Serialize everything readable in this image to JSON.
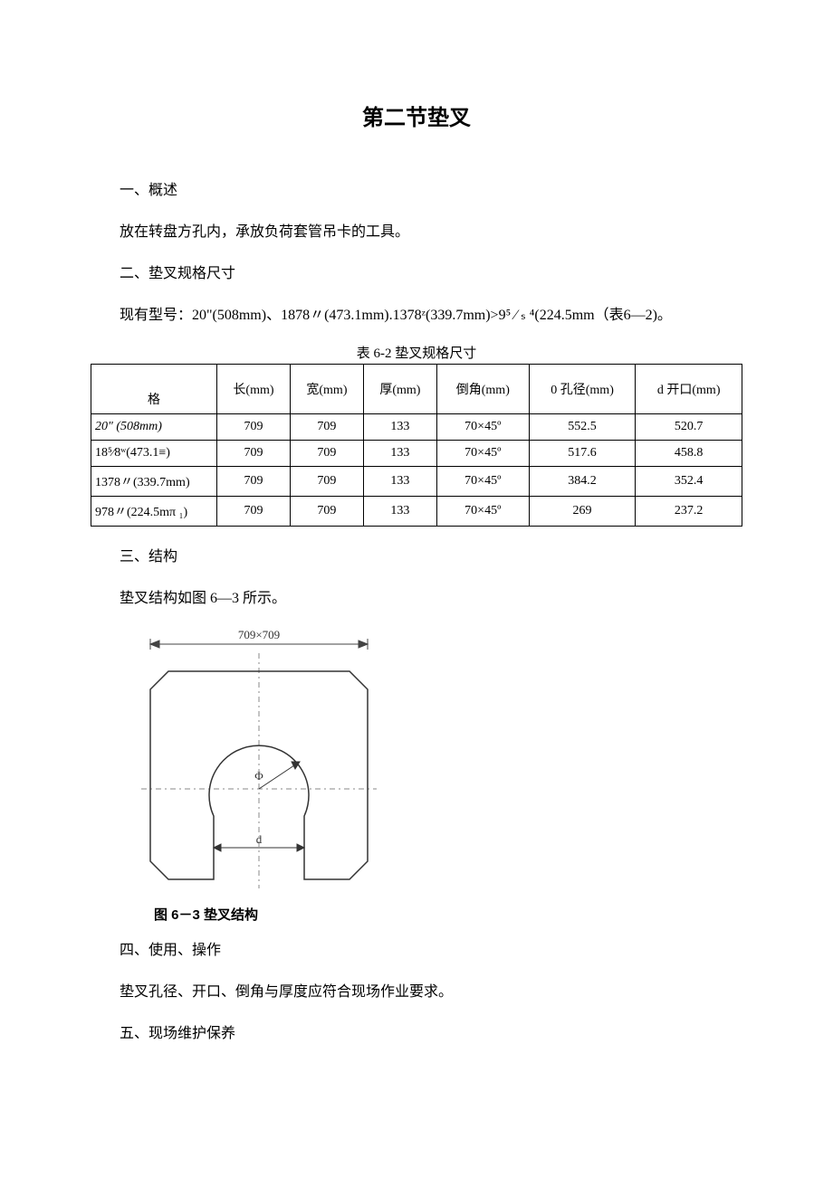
{
  "title": "第二节垫叉",
  "sec1_heading": "一、概述",
  "sec1_text": "放在转盘方孔内，承放负荷套管吊卡的工具。",
  "sec2_heading": "二、垫叉规格尺寸",
  "sec2_text": "现有型号：20\"(508mm)、1878〃(473.1mm).1378ᶻ(339.7mm)>9⁵ ∕ ₛ ⁴(224.5mm（表6—2)。",
  "table_caption": "表 6-2 垫叉规格尺寸",
  "table": {
    "headers": {
      "spec": "格",
      "length": "长(mm)",
      "width": "宽(mm)",
      "thick": "厚(mm)",
      "chamfer": "倒角(mm)",
      "diameter": "0 孔径(mm)",
      "opening": "d 开口(mm)"
    },
    "rows": [
      {
        "spec": "20\" (508mm)",
        "length": "709",
        "width": "709",
        "thick": "133",
        "chamfer": "70×45º",
        "diameter": "552.5",
        "opening": "520.7"
      },
      {
        "spec": "18⁵⁄8ʷ(473.1≡)",
        "length": "709",
        "width": "709",
        "thick": "133",
        "chamfer": "70×45º",
        "diameter": "517.6",
        "opening": "458.8"
      },
      {
        "spec": "1378〃(339.7mm)",
        "length": "709",
        "width": "709",
        "thick": "133",
        "chamfer": "70×45º",
        "diameter": "384.2",
        "opening": "352.4"
      },
      {
        "spec": "978〃(224.5mπ ₁)",
        "length": "709",
        "width": "709",
        "thick": "133",
        "chamfer": "70×45º",
        "diameter": "269",
        "opening": "237.2"
      }
    ]
  },
  "sec3_heading": "三、结构",
  "sec3_text": "垫叉结构如图 6—3 所示。",
  "figure": {
    "dim_top": "709×709",
    "phi": "Φ",
    "d": "d",
    "caption": "图 6－3 垫叉结构"
  },
  "sec4_heading": "四、使用、操作",
  "sec4_text": "垫叉孔径、开口、倒角与厚度应符合现场作业要求。",
  "sec5_heading": "五、现场维护保养"
}
